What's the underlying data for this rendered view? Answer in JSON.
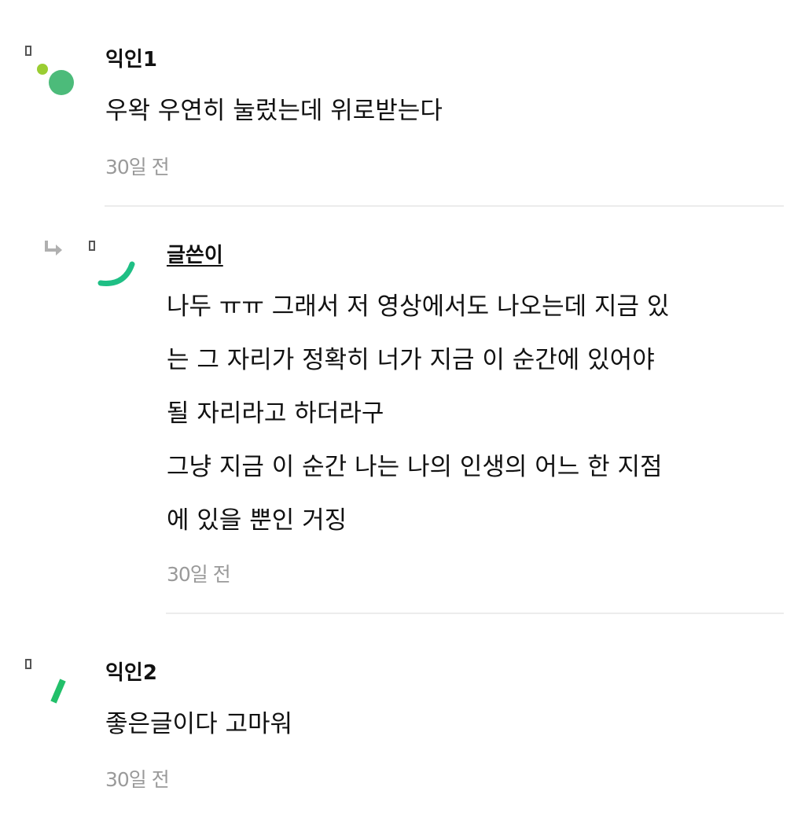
{
  "comments": [
    {
      "nickname": "익인1",
      "lines": [
        "우왁 우연히 눌렀는데 위로받는다"
      ],
      "time": "30일 전",
      "is_reply": false,
      "avatar_icon": "dots-avatar-icon",
      "colors": {
        "dot_small": "#9acd32",
        "dot_large": "#4cbb7a"
      }
    },
    {
      "nickname": "글쓴이",
      "lines": [
        "나두 ㅠㅠ 그래서 저 영상에서도 나오는데 지금 있",
        "는 그 자리가 정확히 너가 지금 이 순간에 있어야",
        "될 자리라고 하더라구",
        "그냥 지금 이 순간 나는 나의 인생의 어느 한 지점",
        "에 있을 뿐인 거징"
      ],
      "time": "30일 전",
      "is_reply": true,
      "avatar_icon": "arc-avatar-icon",
      "colors": {
        "arc": "#1fbf85"
      }
    },
    {
      "nickname": "익인2",
      "lines": [
        "좋은글이다 고마워"
      ],
      "time": "30일 전",
      "is_reply": false,
      "avatar_icon": "slash-avatar-icon",
      "colors": {
        "slash": "#22c06a"
      }
    }
  ],
  "icons": {
    "reply": "reply-arrow-icon",
    "status": "status-marker-icon"
  }
}
